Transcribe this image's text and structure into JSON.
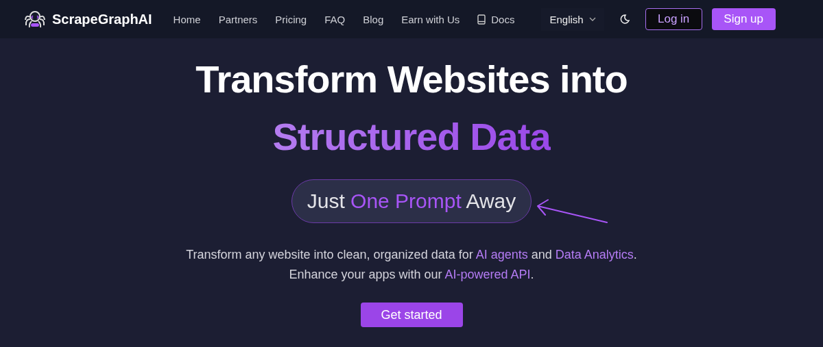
{
  "nav": {
    "brand": "ScrapeGraphAI",
    "links": [
      {
        "label": "Home",
        "kind": "text"
      },
      {
        "label": "Partners",
        "kind": "text"
      },
      {
        "label": "Pricing",
        "kind": "text"
      },
      {
        "label": "FAQ",
        "kind": "text"
      },
      {
        "label": "Blog",
        "kind": "text"
      },
      {
        "label": "Earn with Us",
        "kind": "text"
      },
      {
        "label": "Docs",
        "kind": "book"
      }
    ],
    "language": "English",
    "login": "Log in",
    "signup": "Sign up"
  },
  "hero": {
    "title": "Transform Websites into",
    "subtitle": "Structured Data",
    "pill": [
      {
        "text": "Just ",
        "highlight": false
      },
      {
        "text": "One Prompt",
        "highlight": true
      },
      {
        "text": " Away",
        "highlight": false
      }
    ],
    "lines": [
      [
        {
          "text": "Transform any website into clean, organized data for ",
          "highlight": false
        },
        {
          "text": "AI agents",
          "highlight": true
        },
        {
          "text": " and ",
          "highlight": false
        },
        {
          "text": "Data Analytics",
          "highlight": true
        },
        {
          "text": ".",
          "highlight": false
        }
      ],
      [
        {
          "text": "Enhance your apps with our ",
          "highlight": false
        },
        {
          "text": "AI-powered API",
          "highlight": true
        },
        {
          "text": ".",
          "highlight": false
        }
      ]
    ],
    "cta": "Get started"
  }
}
